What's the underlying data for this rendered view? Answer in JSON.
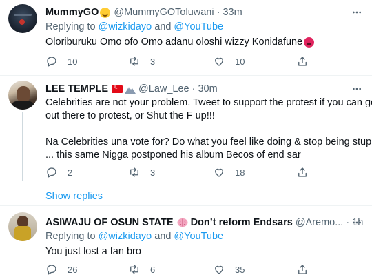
{
  "tweets": [
    {
      "name": "MummyGO",
      "handle": "@MummyGOToluwani",
      "time": "33m",
      "replying_prefix": "Replying to",
      "replying_user1": "@wizkidayo",
      "replying_and": "and",
      "replying_user2": "@YouTube",
      "lines": [
        "Oloriburuku Omo ofo Omo adanu oloshi wizzy Konidafune"
      ],
      "reply_count": "10",
      "retweet_count": "3",
      "like_count": "10"
    },
    {
      "name": "LEE TEMPLE",
      "handle": "@Law_Lee",
      "time": "30m",
      "lines": [
        "Celebrities are not your problem. Tweet to support the protest if you can go",
        "out there to protest, or Shut the F up!!!",
        "",
        "Na Celebrities una vote for? Do what you feel like doing & stop being stupid",
        "... this same Nigga postponed his album Becos of end sar"
      ],
      "reply_count": "2",
      "retweet_count": "3",
      "like_count": "18",
      "show_replies": "Show replies"
    },
    {
      "name": "ASIWAJU OF OSUN STATE",
      "name_suffix": "Don’t reform Endsars",
      "handle": "@Aremo...",
      "time": "1h",
      "replying_prefix": "Replying to",
      "replying_user1": "@wizkidayo",
      "replying_and": "and",
      "replying_user2": "@YouTube",
      "lines": [
        "You just lost a fan bro"
      ],
      "reply_count": "26",
      "retweet_count": "6",
      "like_count": "35"
    }
  ],
  "separator": "·",
  "icons": [
    "more-icon",
    "reply-icon",
    "retweet-icon",
    "like-icon",
    "share-icon",
    "smile-emoji",
    "angry-emoji",
    "turkey-flag-emoji",
    "mountain-emoji",
    "brain-emoji"
  ],
  "colors": {
    "link": "#1d9bf0",
    "secondary": "#536471",
    "primary_text": "#0f1419",
    "divider": "#eff3f4"
  }
}
